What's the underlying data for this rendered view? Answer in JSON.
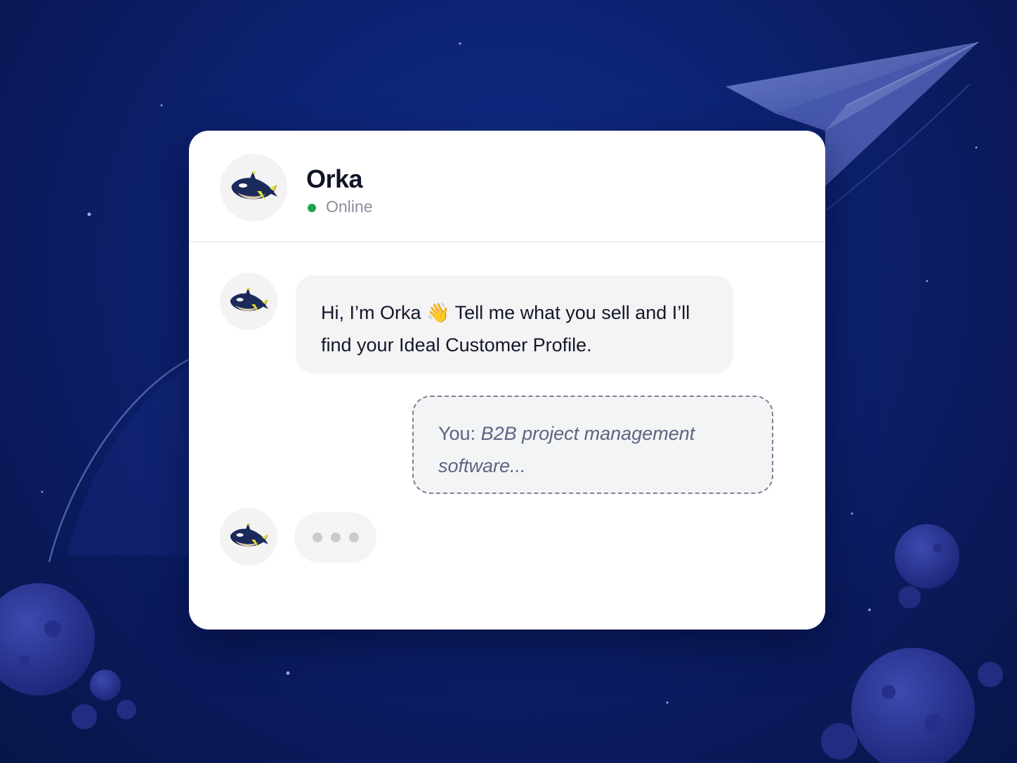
{
  "colors": {
    "background": "#0d2272",
    "card": "#ffffff",
    "online_status": "#1fa64a",
    "bubble": "#f4f4f5"
  },
  "header": {
    "avatar_icon": "orca-mascot-icon",
    "agent_name": "Orka",
    "status": "Online"
  },
  "messages": [
    {
      "sender": "bot",
      "avatar_icon": "orca-mascot-icon",
      "text": "Hi, I’m Orka 👋 Tell me what you sell and I’ll find your Ideal Customer Profile."
    },
    {
      "sender": "user",
      "prefix": "You:",
      "text": "B2B project management software..."
    }
  ],
  "typing_indicator": {
    "avatar_icon": "orca-mascot-icon",
    "dots": 3
  },
  "decorations": [
    "paper-plane-icon",
    "planet-arc",
    "moon-bottom-left",
    "moon-bottom-right",
    "stars"
  ]
}
